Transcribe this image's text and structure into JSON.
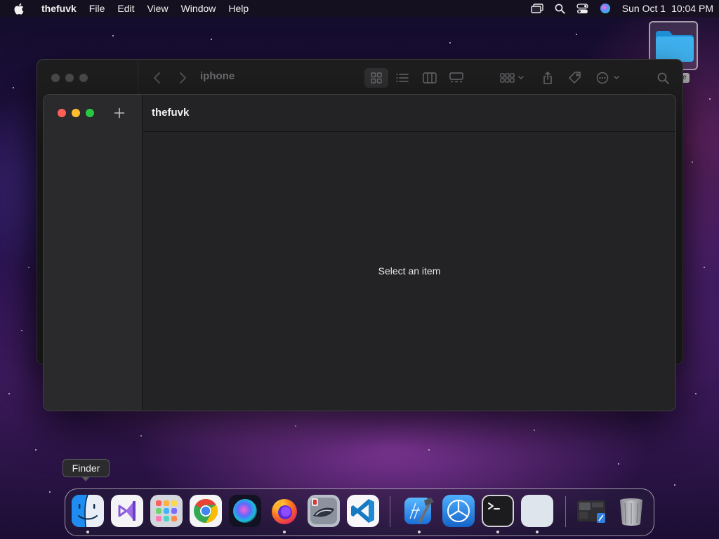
{
  "menubar": {
    "app_name": "thefuvk",
    "menus": [
      "File",
      "Edit",
      "View",
      "Window",
      "Help"
    ],
    "status_icons": [
      "screen-mirroring-icon",
      "spotlight-search-icon",
      "control-center-icon",
      "siri-icon"
    ],
    "date": "Sun Oct 1",
    "time": "10:04 PM"
  },
  "desktop": {
    "folder_icon": "folder-icon",
    "folder_label_visible": "e"
  },
  "finder_window": {
    "title": "iphone",
    "toolbar_icons": [
      "back-icon",
      "forward-icon",
      "icon-view-icon",
      "list-view-icon",
      "column-view-icon",
      "gallery-view-icon",
      "group-icon",
      "share-icon",
      "tag-icon",
      "more-actions-icon",
      "search-icon"
    ]
  },
  "app_window": {
    "header_title": "thefuvk",
    "empty_message": "Select an item",
    "add_icon": "plus-icon"
  },
  "tooltip": {
    "text": "Finder"
  },
  "dock": {
    "apps": [
      "Finder",
      "Visual Studio",
      "Launchpad",
      "Google Chrome",
      "Siri",
      "Firefox",
      "Migration Assistant",
      "Visual Studio Code",
      "Xcode",
      "Instruments",
      "Terminal",
      "Blank App"
    ],
    "running": [
      "Finder",
      "Firefox",
      "Xcode",
      "Terminal",
      "Blank App"
    ],
    "extras": [
      "Downloads stack",
      "Trash"
    ]
  },
  "colors": {
    "traffic_red": "#ff5f57",
    "traffic_yellow": "#febc2e",
    "traffic_green": "#28c840",
    "window_bg": "#232325",
    "sidebar_bg": "#2a2a2c"
  }
}
